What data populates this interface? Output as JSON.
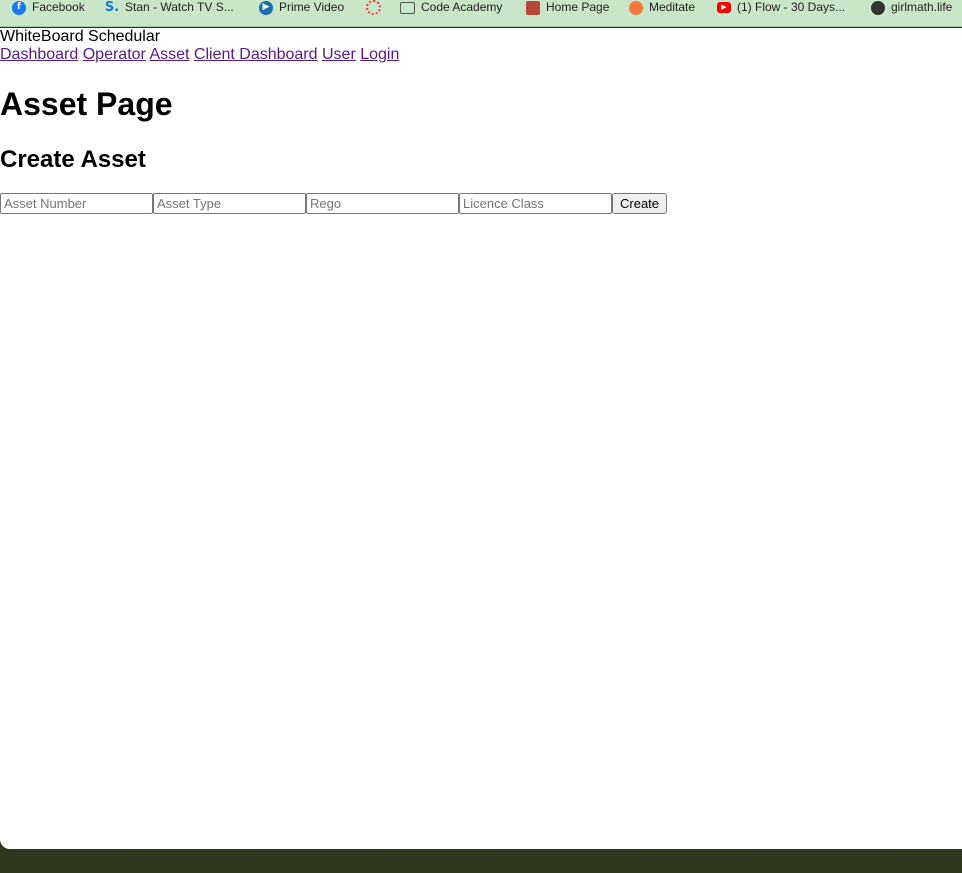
{
  "bookmarks": [
    {
      "label": "Facebook",
      "icon": "facebook-icon",
      "color": "#1877f2"
    },
    {
      "label": "Stan - Watch TV S...",
      "icon": "stan-icon",
      "color": "#0f7cd9"
    },
    {
      "label": "Prime Video",
      "icon": "prime-video-icon",
      "color": "#1a6fb0"
    },
    {
      "label": "",
      "icon": "loading-ring-icon",
      "color": "#e8452c"
    },
    {
      "label": "Code Academy",
      "icon": "folder-icon",
      "color": "#555555"
    },
    {
      "label": "Home Page",
      "icon": "avatar-icon",
      "color": "#b5473a"
    },
    {
      "label": "Meditate",
      "icon": "meditate-icon",
      "color": "#f5793a"
    },
    {
      "label": "(1) Flow - 30 Days...",
      "icon": "youtube-icon",
      "color": "#ff0000"
    },
    {
      "label": "girlmath.life",
      "icon": "globe-icon",
      "color": "#333333"
    }
  ],
  "header": {
    "brand": "WhiteBoard Schedular",
    "nav": [
      "Dashboard",
      "Operator",
      "Asset",
      "Client Dashboard",
      "User",
      "Login"
    ]
  },
  "page": {
    "title": "Asset Page",
    "section_title": "Create Asset"
  },
  "form": {
    "asset_number_placeholder": "Asset Number",
    "asset_type_placeholder": "Asset Type",
    "rego_placeholder": "Rego",
    "licence_class_placeholder": "Licence Class",
    "submit_label": "Create"
  }
}
